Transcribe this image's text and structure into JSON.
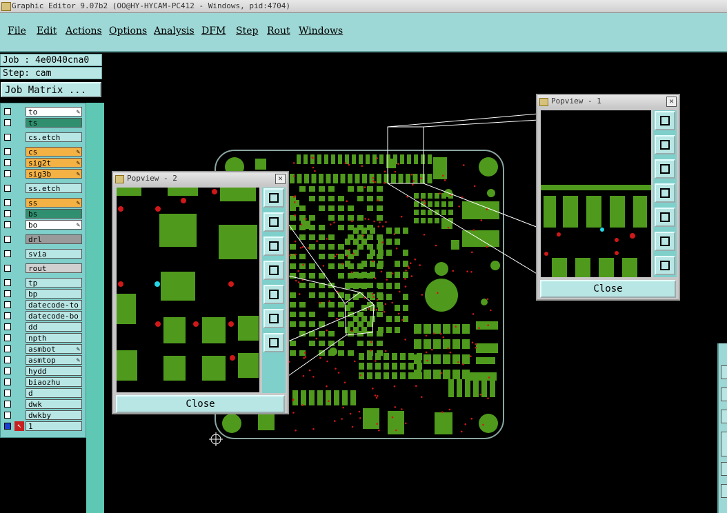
{
  "window": {
    "title": "Graphic Editor 9.07b2 (OO@HY-HYCAM-PC412 - Windows, pid:4704)"
  },
  "menu": [
    "File",
    "Edit",
    "Actions",
    "Options",
    "Analysis",
    "DFM",
    "Step",
    "Rout",
    "Windows"
  ],
  "job": {
    "job_label": "Job : 4e0040cna0",
    "step_label": "Step: cam",
    "matrix_button": "Job Matrix ..."
  },
  "layers": [
    {
      "name": "to",
      "color": "#ffffff",
      "mark": "✎"
    },
    {
      "name": "ts",
      "color": "#2f8f6f",
      "mark": ""
    },
    {
      "name": "cs.etch",
      "color": "#b8e6e4",
      "mark": ""
    },
    {
      "name": "cs",
      "color": "#f5b244",
      "mark": "✎"
    },
    {
      "name": "sig2t",
      "color": "#f5b244",
      "mark": "✎"
    },
    {
      "name": "sig3b",
      "color": "#f5b244",
      "mark": "✎"
    },
    {
      "name": "ss.etch",
      "color": "#b8e6e4",
      "mark": ""
    },
    {
      "name": "ss",
      "color": "#f5b244",
      "mark": "✎"
    },
    {
      "name": "bs",
      "color": "#2f8f6f",
      "mark": ""
    },
    {
      "name": "bo",
      "color": "#ffffff",
      "mark": "✎"
    },
    {
      "name": "drl",
      "color": "#9a9a9a",
      "mark": ""
    },
    {
      "name": "svia",
      "color": "#b8e6e4",
      "mark": ""
    },
    {
      "name": "rout",
      "color": "#d0d0d0",
      "mark": ""
    },
    {
      "name": "tp",
      "color": "#b8e6e4",
      "mark": ""
    },
    {
      "name": "bp",
      "color": "#b8e6e4",
      "mark": ""
    },
    {
      "name": "datecode-to",
      "color": "#b8e6e4",
      "mark": ""
    },
    {
      "name": "datecode-bo",
      "color": "#b8e6e4",
      "mark": ""
    },
    {
      "name": "dd",
      "color": "#b8e6e4",
      "mark": ""
    },
    {
      "name": "npth",
      "color": "#b8e6e4",
      "mark": ""
    },
    {
      "name": "asmbot",
      "color": "#b8e6e4",
      "mark": "✎"
    },
    {
      "name": "asmtop",
      "color": "#b8e6e4",
      "mark": "✎"
    },
    {
      "name": "hydd",
      "color": "#b8e6e4",
      "mark": ""
    },
    {
      "name": "biaozhu",
      "color": "#b8e6e4",
      "mark": ""
    },
    {
      "name": "d",
      "color": "#b8e6e4",
      "mark": ""
    },
    {
      "name": "dwk",
      "color": "#b8e6e4",
      "mark": ""
    },
    {
      "name": "dwkby",
      "color": "#b8e6e4",
      "mark": ""
    },
    {
      "name": "1",
      "color": "#b8e6e4",
      "mark": ""
    }
  ],
  "popview1": {
    "title": "Popview - 1",
    "close": "Close"
  },
  "popview2": {
    "title": "Popview - 2",
    "close": "Close"
  },
  "colors": {
    "pad_green": "#4f9a1c",
    "board_outline": "#8aa6a0",
    "via_red": "#d01818",
    "highlight_cyan": "#22d8e8"
  }
}
